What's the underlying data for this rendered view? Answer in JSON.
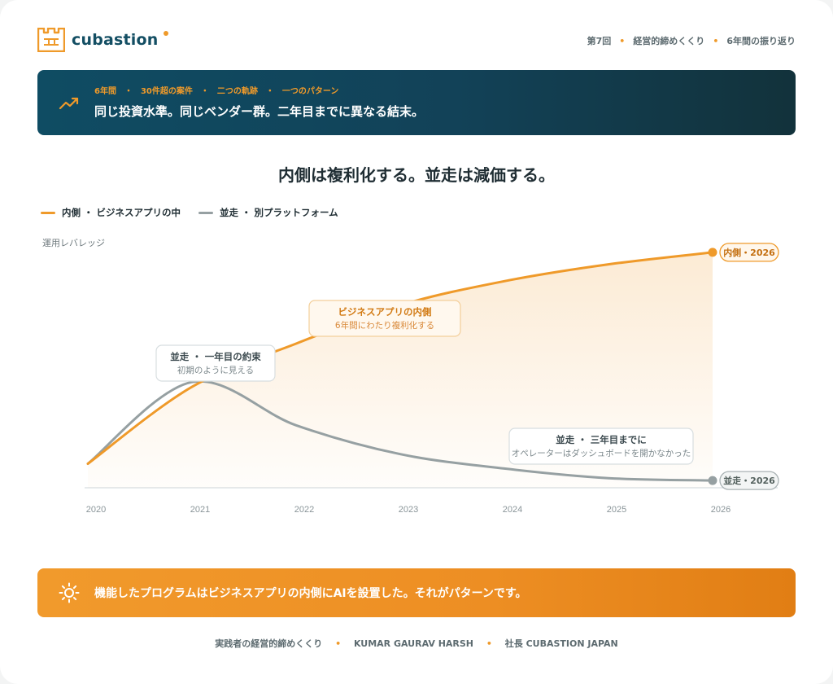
{
  "brand": {
    "name": "cubastion"
  },
  "nav": [
    "第7回",
    "経営的締めくくり",
    "6年間の振り返り"
  ],
  "banner": {
    "kicker": [
      "6年間",
      "30件超の案件",
      "二つの軌跡",
      "一つのパターン"
    ],
    "title": "同じ投資水準。同じベンダー群。二年目までに異なる結末。",
    "icon": "trend-up-icon"
  },
  "chart_data": {
    "type": "line",
    "title": "内側は複利化する。並走は減価する。",
    "ylabel": "運用レバレッジ",
    "xlabel": "",
    "x": [
      "2020",
      "2021",
      "2022",
      "2023",
      "2024",
      "2025",
      "2026"
    ],
    "ylim": [
      0,
      100
    ],
    "grid": false,
    "legend_placement": "top-left",
    "series": [
      {
        "name": "内側 ・ ビジネスアプリの中",
        "color": "#ef9a2a",
        "values": [
          10,
          42,
          60,
          76,
          86,
          93,
          98
        ],
        "end_label": "内側・2026",
        "area": true
      },
      {
        "name": "並走 ・ 別プラットフォーム",
        "color": "#96a0a2",
        "values": [
          10,
          44,
          26,
          14,
          8,
          4,
          3
        ],
        "end_label": "並走・2026",
        "area": false
      }
    ],
    "annotations": [
      {
        "x": "2021",
        "y": 56,
        "title": "並走 ・ 一年目の約束",
        "subtitle": "初期のように見える",
        "style": "gray"
      },
      {
        "x": "2023",
        "y": 76,
        "title": "ビジネスアプリの内側",
        "subtitle": "6年間にわたり複利化する",
        "style": "orange"
      },
      {
        "x": "2024",
        "y": 19,
        "title": "並走 ・ 三年目までに",
        "subtitle": "オペレーターはダッシュボードを開かなかった",
        "style": "gray"
      }
    ]
  },
  "callout": {
    "icon": "sun-icon",
    "text": "機能したプログラムはビジネスアプリの内側にAIを設置した。それがパターンです。"
  },
  "footer": [
    "実践者の経営的締めくくり",
    "KUMAR GAURAV HARSH",
    "社長 CUBASTION JAPAN"
  ],
  "colors": {
    "accent": "#ef9a2a",
    "navy": "#134e63",
    "muted": "#96a0a2"
  }
}
